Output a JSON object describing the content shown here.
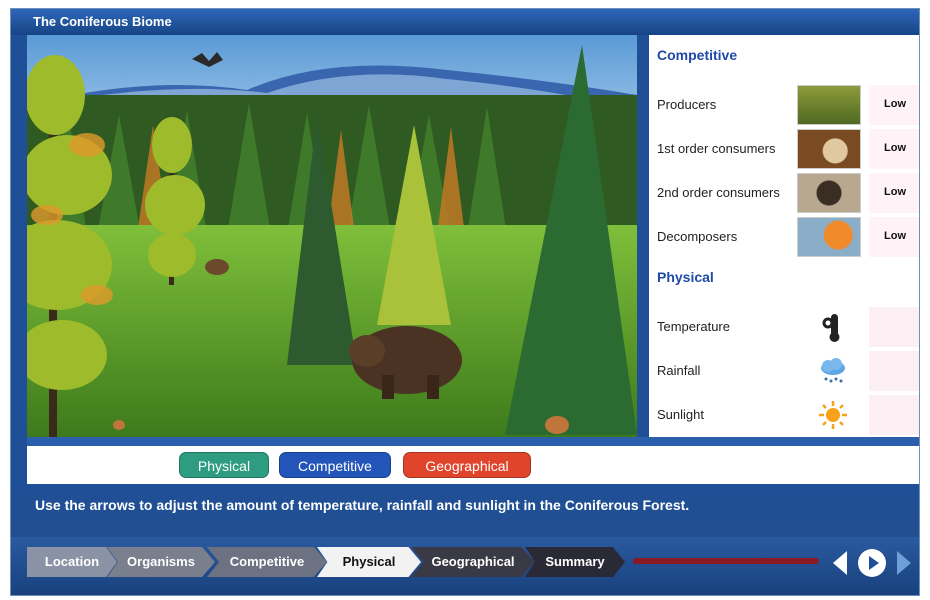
{
  "app": {
    "title": "The Coniferous Biome"
  },
  "panel": {
    "competitive": {
      "title": "Competitive",
      "rows": [
        {
          "label": "Producers",
          "level": "Low",
          "thumb": "shrub-photo"
        },
        {
          "label": "1st order consumers",
          "level": "Low",
          "thumb": "rabbit-photo"
        },
        {
          "label": "2nd order consumers",
          "level": "Low",
          "thumb": "bird-photo"
        },
        {
          "label": "Decomposers",
          "level": "Low",
          "thumb": "fungus-photo"
        }
      ]
    },
    "physical": {
      "title": "Physical",
      "rows": [
        {
          "label": "Temperature",
          "icon": "thermometer-icon"
        },
        {
          "label": "Rainfall",
          "icon": "rain-cloud-icon"
        },
        {
          "label": "Sunlight",
          "icon": "sun-icon"
        }
      ]
    }
  },
  "tabs": [
    {
      "label": "Physical",
      "color": "#2e9c80"
    },
    {
      "label": "Competitive",
      "color": "#2355b8"
    },
    {
      "label": "Geographical",
      "color": "#e0452c"
    }
  ],
  "instruction": "Use the arrows to adjust the amount of temperature, rainfall and sunlight in the Coniferous Forest.",
  "breadcrumb": [
    {
      "label": "Location",
      "state": "done"
    },
    {
      "label": "Organisms",
      "state": "done"
    },
    {
      "label": "Competitive",
      "state": "done"
    },
    {
      "label": "Physical",
      "state": "current"
    },
    {
      "label": "Geographical",
      "state": "todo"
    },
    {
      "label": "Summary",
      "state": "todo"
    }
  ],
  "colors": {
    "frame": "#1f4f97",
    "accent": "#1f4aa8",
    "progress": "#8a1a22"
  },
  "nav": {
    "prev_icon": "back-arrow-icon",
    "play_icon": "play-icon",
    "next_icon": "forward-arrow-icon"
  }
}
